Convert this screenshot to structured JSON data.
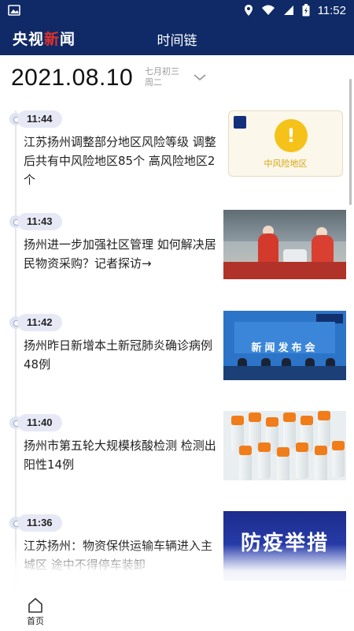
{
  "status_bar": {
    "time": "11:52"
  },
  "app_bar": {
    "brand_part1": "央视",
    "brand_accent": "新",
    "brand_part2": "闻",
    "title": "时间链"
  },
  "date_header": {
    "date": "2021.08.10",
    "lunar": "七月初三",
    "weekday": "周二"
  },
  "timeline": [
    {
      "time": "11:44",
      "headline": "江苏扬州调整部分地区风险等级 调整后共有中风险地区85个 高风险地区2个",
      "thumb_label": "中风险地区",
      "thumb_logo": "央视新闻"
    },
    {
      "time": "11:43",
      "headline": "扬州进一步加强社区管理 如何解决居民物资采购？记者探访→"
    },
    {
      "time": "11:42",
      "headline": "扬州昨日新增本土新冠肺炎确诊病例48例",
      "thumb_banner": "新闻发布会"
    },
    {
      "time": "11:40",
      "headline": "扬州市第五轮大规模核酸检测 检测出阳性14例"
    },
    {
      "time": "11:36",
      "headline": "江苏扬州：物资保供运输车辆进入主城区 途中不得停车装卸",
      "thumb_text": "防疫举措"
    }
  ],
  "bottom_nav": {
    "home_label": "首页"
  },
  "colors": {
    "primary": "#0f2a66",
    "accent_red": "#e0312a",
    "time_pill": "#e6e9f5",
    "warning_yellow": "#f5c21a"
  }
}
